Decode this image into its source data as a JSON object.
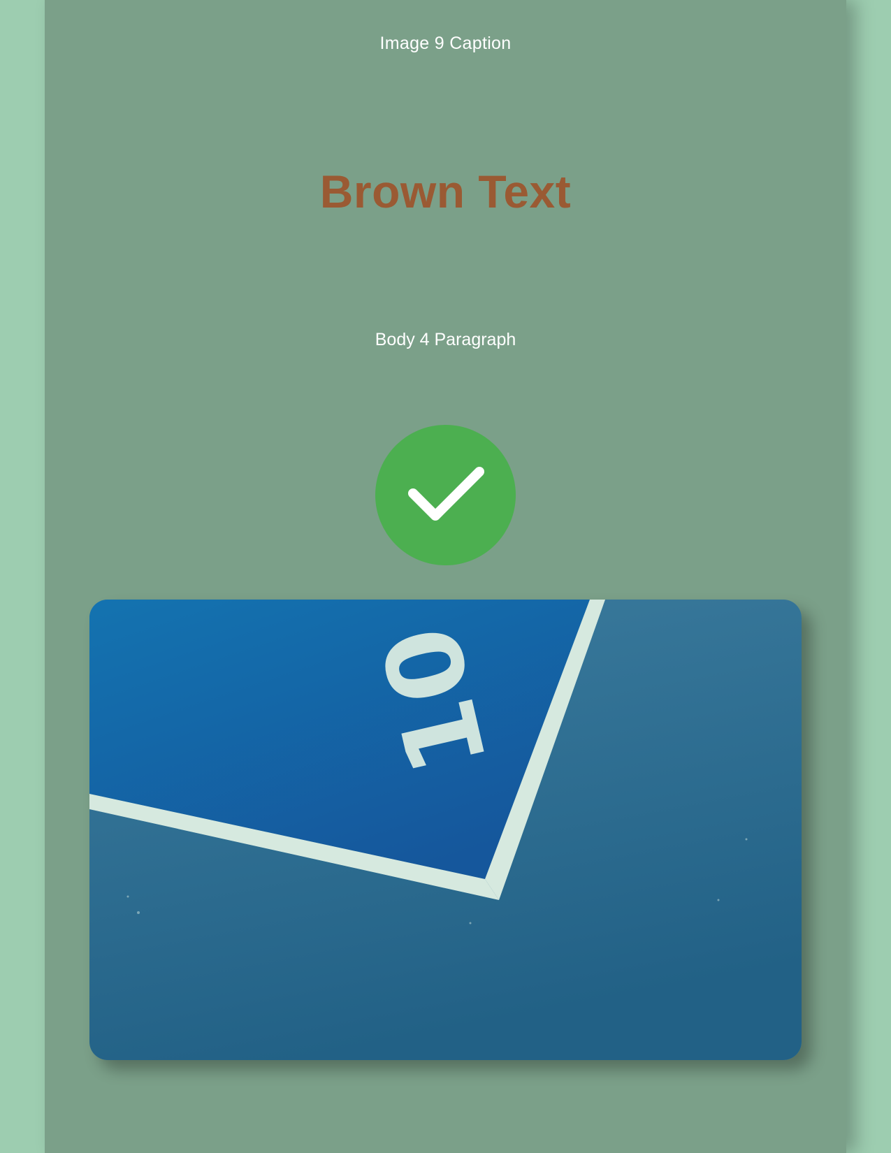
{
  "caption": "Image 9 Caption",
  "heading": {
    "text": "Brown Text",
    "color": "#9a5a33"
  },
  "body": "Body 4 Paragraph",
  "check_badge": {
    "icon": "checkmark-icon",
    "color": "#4caf50"
  },
  "photo": {
    "number": "10"
  },
  "colors": {
    "outer_background": "#9dcdb0",
    "page_background": "#7ba089"
  }
}
